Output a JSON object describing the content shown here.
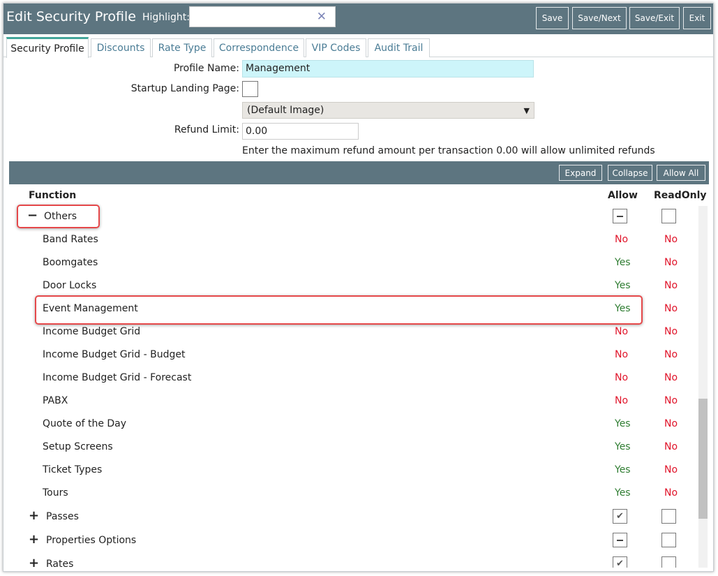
{
  "header": {
    "title": "Edit Security Profile",
    "highlight_label": "Highlight:",
    "highlight_value": "",
    "buttons": [
      "Save",
      "Save/Next",
      "Save/Exit",
      "Exit"
    ]
  },
  "tabs": [
    "Security Profile",
    "Discounts",
    "Rate Type",
    "Correspondence",
    "VIP Codes",
    "Audit Trail"
  ],
  "form": {
    "profile_name_label": "Profile Name:",
    "profile_name": "Management",
    "startup_label": "Startup Landing Page:",
    "default_image": "(Default Image)",
    "refund_label": "Refund Limit:",
    "refund_value": "0.00",
    "refund_hint": "Enter the maximum refund amount per transaction 0.00 will allow unlimited refunds"
  },
  "table_actions": [
    "Expand",
    "Collapse",
    "Allow All"
  ],
  "columns": {
    "function": "Function",
    "allow": "Allow",
    "readonly": "ReadOnly"
  },
  "groups": [
    {
      "sign": "−",
      "name": "Others",
      "allow_state": "indeterminate",
      "readonly_state": "unchecked"
    },
    {
      "sign": "+",
      "name": "Passes",
      "allow_state": "checked",
      "readonly_state": "unchecked"
    },
    {
      "sign": "+",
      "name": "Properties Options",
      "allow_state": "indeterminate",
      "readonly_state": "unchecked"
    },
    {
      "sign": "+",
      "name": "Rates",
      "allow_state": "checked",
      "readonly_state": "unchecked"
    }
  ],
  "others_items": [
    {
      "name": "Band Rates",
      "allow": "No",
      "readonly": "No"
    },
    {
      "name": "Boomgates",
      "allow": "Yes",
      "readonly": "No"
    },
    {
      "name": "Door Locks",
      "allow": "Yes",
      "readonly": "No"
    },
    {
      "name": "Event Management",
      "allow": "Yes",
      "readonly": "No"
    },
    {
      "name": "Income Budget Grid",
      "allow": "No",
      "readonly": "No"
    },
    {
      "name": "Income Budget Grid - Budget",
      "allow": "No",
      "readonly": "No"
    },
    {
      "name": "Income Budget Grid - Forecast",
      "allow": "No",
      "readonly": "No"
    },
    {
      "name": "PABX",
      "allow": "No",
      "readonly": "No"
    },
    {
      "name": "Quote of the Day",
      "allow": "Yes",
      "readonly": "No"
    },
    {
      "name": "Setup Screens",
      "allow": "Yes",
      "readonly": "No"
    },
    {
      "name": "Ticket Types",
      "allow": "Yes",
      "readonly": "No"
    },
    {
      "name": "Tours",
      "allow": "Yes",
      "readonly": "No"
    }
  ],
  "icons": {
    "clear": "close-icon",
    "check": "checkmark-icon",
    "select": "chevron-down-icon"
  },
  "colors": {
    "header": "#5d7580",
    "yes": "#2f7d32",
    "no": "#e0142a",
    "highlight_box": "#e5484a",
    "tab_accent": "#43a59a"
  }
}
